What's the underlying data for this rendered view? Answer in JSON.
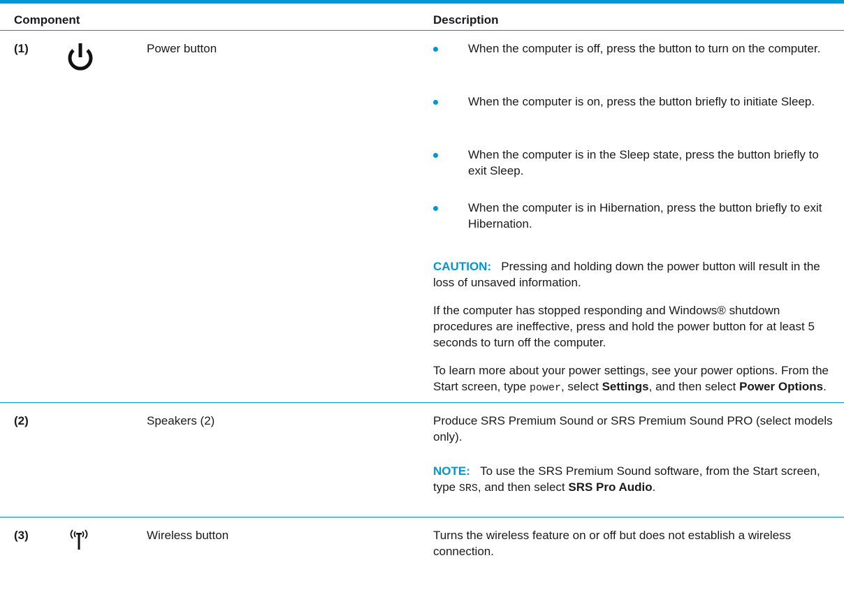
{
  "header": {
    "component": "Component",
    "description": "Description"
  },
  "rows": [
    {
      "number": "(1)",
      "icon": "power-icon",
      "name": "Power button",
      "bullets": [
        "When the computer is off, press the button to turn on the computer.",
        "When the computer is on, press the button briefly to initiate Sleep.",
        "When the computer is in the Sleep state, press the button briefly to exit Sleep.",
        "When the computer is in Hibernation, press the button briefly to exit Hibernation."
      ],
      "caution_label": "CAUTION:",
      "caution_text": "Pressing and holding down the power button will result in the loss of unsaved information.",
      "para1": "If the computer has stopped responding and Windows® shutdown procedures are ineffective, press and hold the power button for at least 5 seconds to turn off the computer.",
      "para2_a": "To learn more about your power settings, see your power options. From the Start screen, type ",
      "para2_code": "power",
      "para2_b": ", select ",
      "para2_bold1": "Settings",
      "para2_c": ", and then select ",
      "para2_bold2": "Power Options",
      "para2_d": "."
    },
    {
      "number": "(2)",
      "name": "Speakers (2)",
      "desc": "Produce SRS Premium Sound or SRS Premium Sound PRO (select models only).",
      "note_label": "NOTE:",
      "note_a": "To use the SRS Premium Sound software, from the Start screen, type ",
      "note_code": "SRS",
      "note_b": ", and then select ",
      "note_bold": "SRS Pro Audio",
      "note_c": "."
    },
    {
      "number": "(3)",
      "icon": "wireless-icon",
      "name": "Wireless button",
      "desc": "Turns the wireless feature on or off but does not establish a wireless connection."
    }
  ],
  "colors": {
    "accent": "#0096d6",
    "text": "#1a1a1a"
  }
}
